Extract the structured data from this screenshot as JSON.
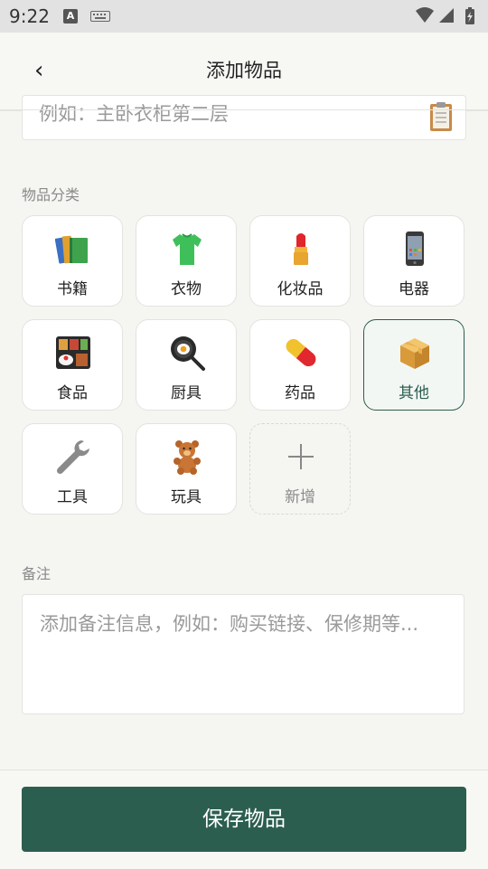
{
  "status_bar": {
    "time": "9:22",
    "input_badge": "A"
  },
  "header": {
    "back_glyph": "‹",
    "title": "添加物品"
  },
  "location": {
    "placeholder": "例如：主卧衣柜第二层",
    "icon": "clipboard-icon"
  },
  "category": {
    "section_label": "物品分类",
    "items": [
      {
        "label": "书籍",
        "icon": "books-icon"
      },
      {
        "label": "衣物",
        "icon": "tshirt-icon"
      },
      {
        "label": "化妆品",
        "icon": "lipstick-icon"
      },
      {
        "label": "电器",
        "icon": "phone-icon"
      },
      {
        "label": "食品",
        "icon": "bento-icon"
      },
      {
        "label": "厨具",
        "icon": "frying-pan-icon"
      },
      {
        "label": "药品",
        "icon": "pill-icon"
      },
      {
        "label": "其他",
        "icon": "package-icon",
        "selected": true
      },
      {
        "label": "工具",
        "icon": "wrench-icon"
      },
      {
        "label": "玩具",
        "icon": "teddy-bear-icon"
      },
      {
        "label": "新增",
        "icon": "plus-icon"
      }
    ]
  },
  "notes": {
    "section_label": "备注",
    "placeholder": "添加备注信息，例如：购买链接、保修期等..."
  },
  "footer": {
    "save_label": "保存物品"
  },
  "colors": {
    "primary": "#2c5e50",
    "background": "#f5f5f2",
    "card": "#ffffff"
  }
}
